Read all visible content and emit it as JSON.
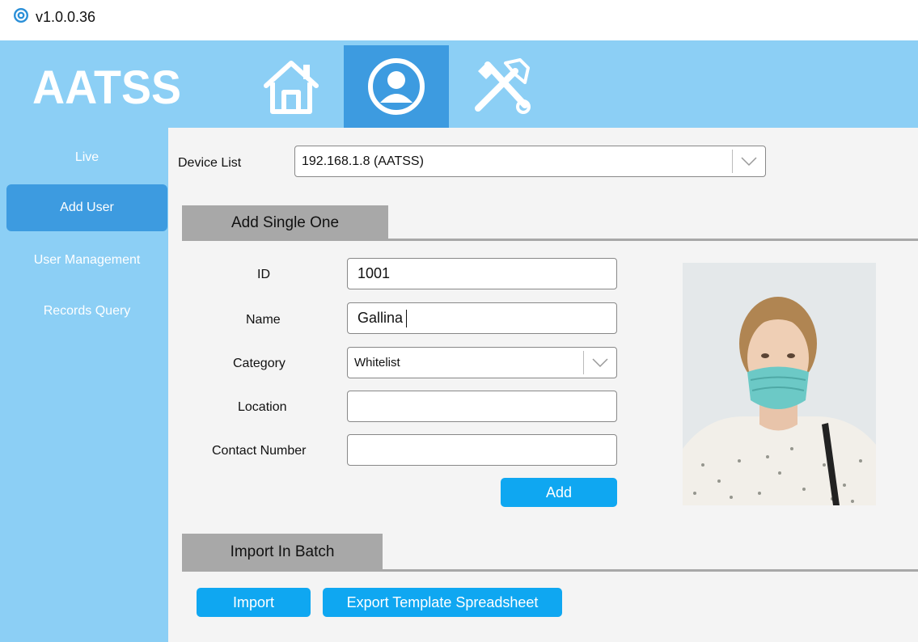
{
  "window": {
    "version": "v1.0.0.36"
  },
  "header": {
    "logo_text": "AATSS"
  },
  "sidebar": {
    "items": [
      {
        "label": "Live"
      },
      {
        "label": "Add User"
      },
      {
        "label": "User Management"
      },
      {
        "label": "Records Query"
      }
    ]
  },
  "device": {
    "label": "Device List",
    "selected": "192.168.1.8 (AATSS)"
  },
  "single": {
    "tab_label": "Add Single One",
    "id_label": "ID",
    "id_value": "1001",
    "name_label": "Name",
    "name_value": "Gallina",
    "category_label": "Category",
    "category_value": "Whitelist",
    "location_label": "Location",
    "location_value": "",
    "contact_label": "Contact Number",
    "contact_value": "",
    "add_label": "Add"
  },
  "batch": {
    "tab_label": "Import In Batch",
    "import_label": "Import",
    "export_label": "Export Template Spreadsheet"
  },
  "colors": {
    "nav_bg": "#8ccff5",
    "active_bg": "#3d9be0",
    "button_bg": "#0fa7f1"
  }
}
